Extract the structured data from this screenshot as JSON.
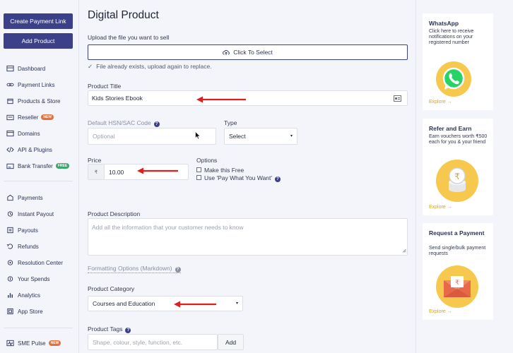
{
  "sidebar": {
    "create_payment_link": "Create Payment Link",
    "add_product": "Add Product",
    "nav": [
      {
        "label": "Dashboard",
        "icon": "dashboard-icon"
      },
      {
        "label": "Payment Links",
        "icon": "link-icon"
      },
      {
        "label": "Products & Store",
        "icon": "products-icon"
      },
      {
        "label": "Reseller",
        "icon": "reseller-icon",
        "badge": "NEW",
        "badge_color": "#e3713b"
      },
      {
        "label": "Domains",
        "icon": "domains-icon"
      },
      {
        "label": "API & Plugins",
        "icon": "code-icon"
      },
      {
        "label": "Bank Transfer",
        "icon": "bank-icon",
        "badge": "FREE",
        "badge_color": "#3ca66b"
      }
    ],
    "nav2": [
      {
        "label": "Payments",
        "icon": "payments-icon"
      },
      {
        "label": "Instant Payout",
        "icon": "instant-payout-icon"
      },
      {
        "label": "Payouts",
        "icon": "payouts-icon"
      },
      {
        "label": "Refunds",
        "icon": "refunds-icon"
      },
      {
        "label": "Resolution Center",
        "icon": "resolution-icon"
      },
      {
        "label": "Your Spends",
        "icon": "spends-icon"
      },
      {
        "label": "Analytics",
        "icon": "analytics-icon"
      },
      {
        "label": "App Store",
        "icon": "app-store-icon"
      }
    ],
    "sme_pulse": {
      "label": "SME Pulse",
      "badge": "NEW"
    }
  },
  "main": {
    "title": "Digital Product",
    "upload_label": "Upload the file you want to sell",
    "upload_button": "Click To Select",
    "upload_status": "File already exists, upload again to replace.",
    "product_title_label": "Product Title",
    "product_title_value": "Kids Stories Ebook",
    "hsn_label": "Default HSN/SAC Code",
    "hsn_placeholder": "Optional",
    "type_label": "Type",
    "type_value": "Select",
    "price_label": "Price",
    "price_currency": "₹",
    "price_value": "10.00",
    "options_label": "Options",
    "option_free": "Make this Free",
    "option_pwyw": "Use 'Pay What You Want'",
    "description_label": "Product Description",
    "description_placeholder": "Add all the information that your customer needs to know",
    "formatting_options": "Formatting Options (Markdown)",
    "category_label": "Product Category",
    "category_value": "Courses and Education",
    "tags_label": "Product Tags",
    "tags_placeholder": "Shape, colour, style, function, etc.",
    "tags_add": "Add"
  },
  "right": {
    "cards": [
      {
        "title": "WhatsApp",
        "desc": "Click here to receive notifications on your registered number",
        "cta": "Explore →"
      },
      {
        "title": "Refer and Earn",
        "desc": "Earn vouchers worth ₹500 each for you & your friend",
        "cta": "Explore →"
      },
      {
        "title": "Request a Payment",
        "desc": "Send single/bulk payment requests",
        "cta": "Explore →"
      }
    ]
  },
  "colors": {
    "brand": "#3b4089",
    "arrow": "#e11d1d",
    "accent": "#d9a520"
  }
}
